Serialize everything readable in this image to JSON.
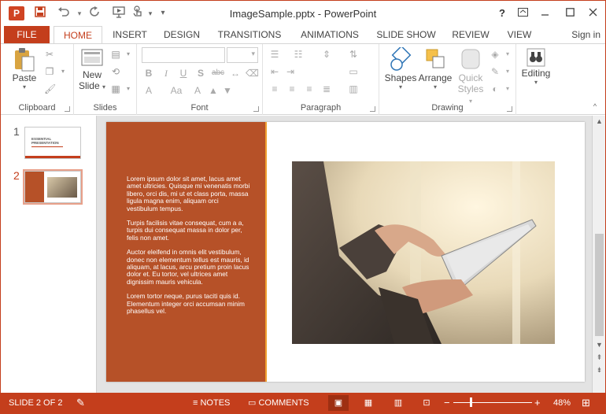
{
  "window": {
    "title": "ImageSample.pptx - PowerPoint",
    "app_logo": "P"
  },
  "qat": {
    "save_icon": "save-icon",
    "undo_icon": "undo-icon",
    "redo_icon": "redo-icon",
    "present_icon": "present-icon",
    "touch_icon": "touch-mode-icon",
    "customize_icon": "customize-icon"
  },
  "window_controls": {
    "help": "?",
    "ribbon_display": "ribbon-display-icon",
    "minimize": "minimize-icon",
    "maximize": "maximize-icon",
    "close": "close-icon"
  },
  "tabs": [
    "FILE",
    "HOME",
    "INSERT",
    "DESIGN",
    "TRANSITIONS",
    "ANIMATIONS",
    "SLIDE SHOW",
    "REVIEW",
    "VIEW"
  ],
  "active_tab": "HOME",
  "signin": "Sign in",
  "ribbon": {
    "clipboard": {
      "label": "Clipboard",
      "paste": "Paste"
    },
    "slides": {
      "label": "Slides",
      "new_slide_line1": "New",
      "new_slide_line2": "Slide"
    },
    "font": {
      "label": "Font"
    },
    "paragraph": {
      "label": "Paragraph"
    },
    "drawing": {
      "label": "Drawing",
      "shapes": "Shapes",
      "arrange": "Arrange",
      "quick_styles_line1": "Quick",
      "quick_styles_line2": "Styles"
    },
    "editing": {
      "label": "Editing"
    },
    "font_buttons": {
      "bold": "B",
      "italic": "I",
      "underline": "U",
      "shadow": "S",
      "strike": "abc"
    }
  },
  "thumbnails": [
    {
      "number": "1",
      "title_line1": "ESSENTIAL",
      "title_line2": "PRESENTATION"
    },
    {
      "number": "2"
    }
  ],
  "slide": {
    "paragraphs": [
      "Lorem ipsum dolor sit amet, lacus amet amet ultricies. Quisque mi venenatis morbi libero, orci dis, mi ut et class porta, massa ligula magna enim, aliquam orci vestibulum tempus.",
      "Turpis facilisis vitae consequat, cum a a, turpis dui consequat massa in dolor per, felis non amet.",
      "Auctor eleifend in omnis elit vestibulum, donec non elementum tellus est mauris, id aliquam, at lacus, arcu pretium proin lacus dolor et. Eu tortor, vel ultrices amet dignissim mauris vehicula.",
      "Lorem tortor neque, purus taciti quis id. Elementum integer orci accumsan minim phasellus vel."
    ],
    "photo_icon": "tablet-photo"
  },
  "status": {
    "slide_info": "SLIDE 2 OF 2",
    "notes": "NOTES",
    "comments": "COMMENTS",
    "zoom": "48%",
    "zoom_minus": "−",
    "zoom_plus": "+"
  },
  "colors": {
    "accent": "#c43e1c",
    "slide_panel": "#b65128",
    "slide_border": "#f0a030"
  }
}
